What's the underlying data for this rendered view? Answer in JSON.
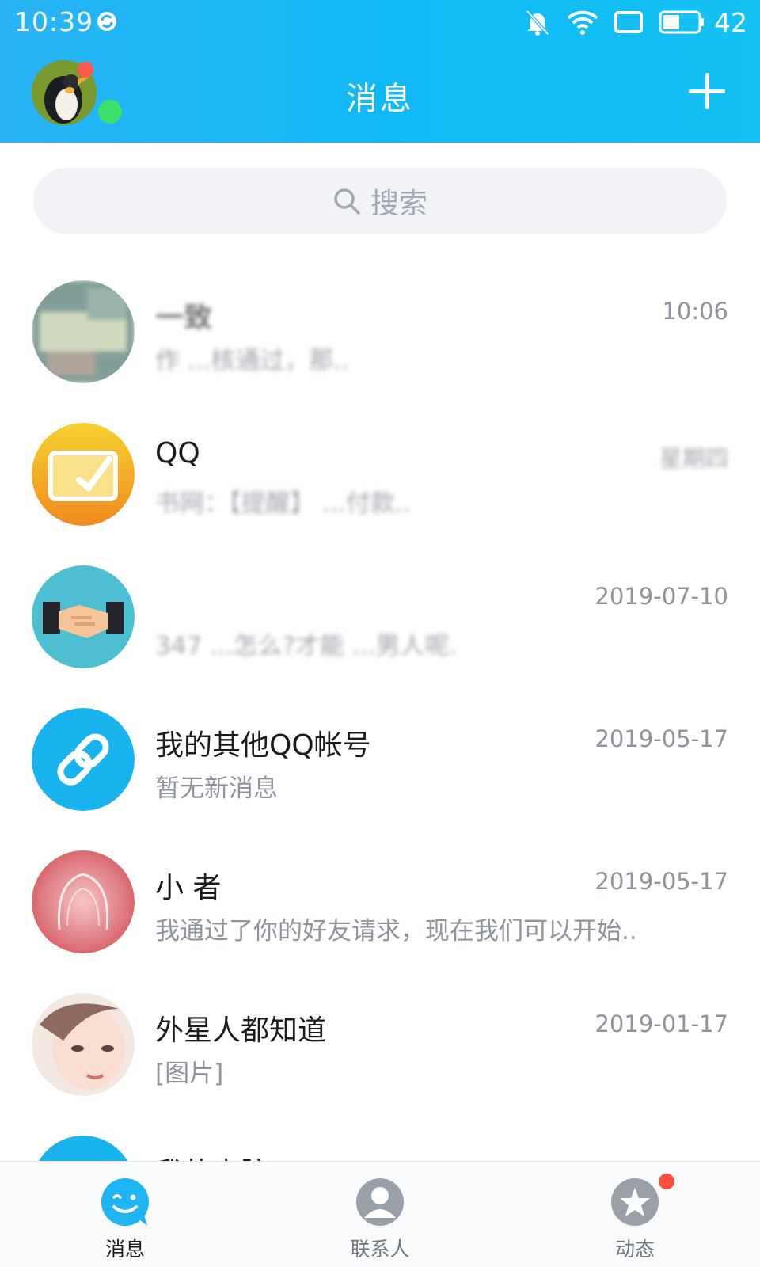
{
  "status_bar": {
    "time": "10:39",
    "battery": "42"
  },
  "header": {
    "title": "消息"
  },
  "search": {
    "placeholder": "搜索"
  },
  "conversations": [
    {
      "name": "一致",
      "time": "10:06",
      "preview": "作 ...核通过，那.."
    },
    {
      "name": "QQ",
      "time": "星期四",
      "preview": "书网：【提醒】 ...付款.."
    },
    {
      "name": "",
      "time": "2019-07-10",
      "preview": "347 ...怎么?才能 ...男人呢."
    },
    {
      "name": "我的其他QQ帐号",
      "time": "2019-05-17",
      "preview": "暂无新消息"
    },
    {
      "name": "小 者",
      "time": "2019-05-17",
      "preview": "我通过了你的好友请求，现在我们可以开始.."
    },
    {
      "name": "外星人都知道",
      "time": "2019-01-17",
      "preview": "[图片]"
    },
    {
      "name": "我的电脑",
      "time": "",
      "preview": ""
    }
  ],
  "tabs": [
    {
      "label": "消息",
      "icon": "chat-face-icon",
      "active": true
    },
    {
      "label": "联系人",
      "icon": "contact-person-icon",
      "active": false
    },
    {
      "label": "动态",
      "icon": "star-planet-icon",
      "active": false,
      "badge": true
    }
  ],
  "colors": {
    "header_gradient_start": "#2ab4f5",
    "header_gradient_end": "#14c2f4",
    "online": "#3ee06b",
    "badge": "#ff4d3d",
    "accent_blue": "#1db4f2"
  }
}
